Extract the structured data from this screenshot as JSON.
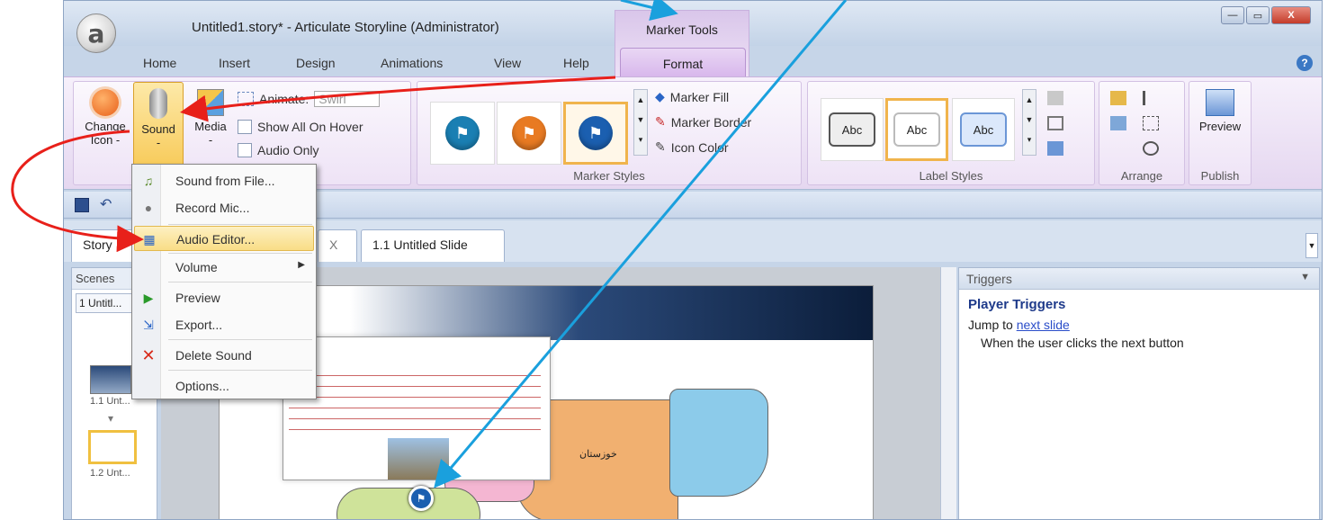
{
  "window": {
    "title": "Untitled1.story* - Articulate Storyline (Administrator)",
    "logo": "a",
    "contextual_group": "Marker Tools",
    "controls": {
      "minimize": "—",
      "maximize": "▭",
      "close": "X"
    }
  },
  "tabs": {
    "home": "Home",
    "insert": "Insert",
    "design": "Design",
    "animations": "Animations",
    "view": "View",
    "help": "Help",
    "format": "Format",
    "help_icon": "?"
  },
  "ribbon": {
    "change_icon": {
      "label": "Change",
      "sub": "Icon -"
    },
    "sound": {
      "label": "Sound",
      "sub": "-"
    },
    "media": {
      "label": "Media",
      "sub": "-"
    },
    "animate": {
      "label": "Animate:",
      "value": "Swirl"
    },
    "show_all_on_hover": "Show All On Hover",
    "audio_only": "Audio Only",
    "marker_styles": {
      "label": "Marker Styles",
      "marker_fill": "Marker Fill",
      "marker_border": "Marker Border",
      "icon_color": "Icon Color"
    },
    "label_styles": {
      "label": "Label Styles",
      "sample": "Abc"
    },
    "arrange": {
      "label": "Arrange"
    },
    "publish": {
      "label": "Publish",
      "preview": "Preview"
    }
  },
  "doc_tabs": {
    "story": "Story",
    "slide_tab": "1.1 Untitled Slide",
    "close": "X"
  },
  "left_panel": {
    "title": "Scenes",
    "scene": "1 Untitl...",
    "thumb1": "1.1 Unt...",
    "thumb2": "1.2 Unt..."
  },
  "sound_menu": {
    "items": [
      {
        "label": "Sound from File...",
        "icon": "sound-file-icon"
      },
      {
        "label": "Record Mic...",
        "icon": "microphone-icon"
      },
      {
        "label": "Audio Editor...",
        "icon": "audio-editor-icon",
        "highlighted": true
      },
      {
        "label": "Volume",
        "icon": "",
        "submenu": true
      },
      {
        "label": "Preview",
        "icon": "play-icon"
      },
      {
        "label": "Export...",
        "icon": "export-icon"
      },
      {
        "label": "Delete Sound",
        "icon": "delete-icon"
      },
      {
        "label": "Options...",
        "icon": ""
      }
    ]
  },
  "triggers": {
    "panel_title": "Triggers",
    "heading": "Player Triggers",
    "jump_prefix": "Jump to",
    "jump_link": "next slide",
    "condition": "When the user clicks the next button"
  },
  "slide": {
    "map_label": "خوزستان"
  },
  "colors": {
    "ribbon_purple": "#e5d7f0",
    "accent_orange": "#f0b44c",
    "arrow_red": "#e8201a",
    "arrow_blue": "#1aa0dd",
    "link_blue": "#2a4dc9"
  }
}
